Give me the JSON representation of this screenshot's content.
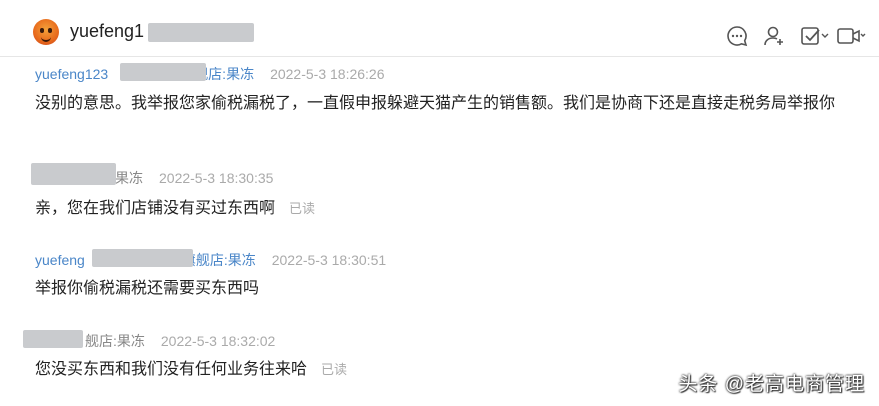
{
  "header": {
    "contact_name": "yuefeng1",
    "icons": [
      "chat-bubble-icon",
      "add-contact-icon",
      "checkbox-icon",
      "video-call-icon"
    ]
  },
  "messages": [
    {
      "sender": "yuefeng123",
      "sender_suffix": "舰店:果冻",
      "time": "2022-5-3 18:26:26",
      "text": "没别的意思。我举报您家偷税漏税了，一直假申报躲避天猫产生的销售额。我们是协商下还是直接走税务局举报你",
      "read": ""
    },
    {
      "sender": "",
      "sender_suffix": "果冻",
      "time": "2022-5-3 18:30:35",
      "text": "亲，您在我们店铺没有买过东西啊",
      "read": "已读"
    },
    {
      "sender": "yuefeng",
      "sender_suffix": "旗舰店:果冻",
      "time": "2022-5-3 18:30:51",
      "text": "举报你偷税漏税还需要买东西吗",
      "read": ""
    },
    {
      "sender": "",
      "sender_suffix": "舰店:果冻",
      "time": "2022-5-3 18:32:02",
      "text": "您没买东西和我们没有任何业务往来哈",
      "read": "已读"
    }
  ],
  "watermark": "头条 @老高电商管理"
}
